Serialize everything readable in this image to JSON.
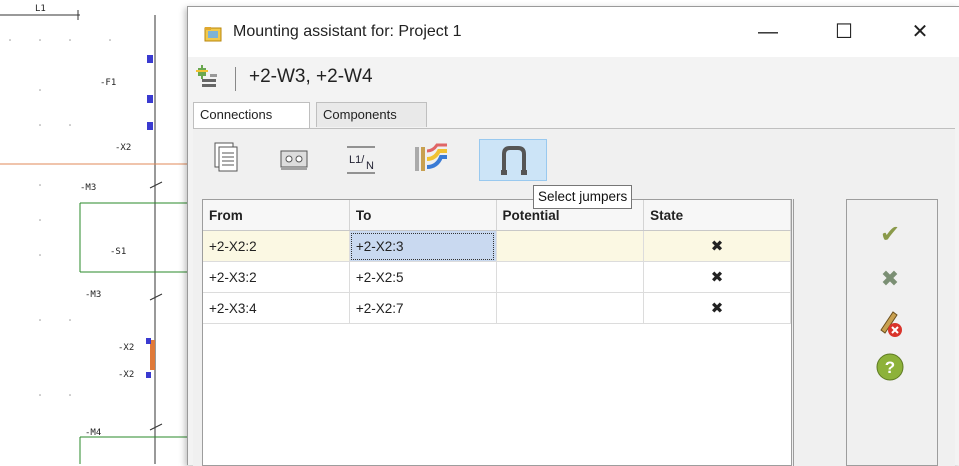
{
  "window": {
    "title": "Mounting assistant for: Project 1",
    "minimize_glyph": "—",
    "maximize_glyph": "☐",
    "close_glyph": "✕"
  },
  "header": {
    "cables": "+2-W3, +2-W4",
    "icon": "cable-connections-icon"
  },
  "tabs": [
    {
      "label": "Connections",
      "active": true
    },
    {
      "label": "Components",
      "active": false
    }
  ],
  "toolbar": {
    "tools": [
      {
        "icon": "document-list-icon"
      },
      {
        "icon": "terminal-icon"
      },
      {
        "icon": "potential-l1-n-icon",
        "label": "L1/N"
      },
      {
        "icon": "wire-bundle-icon"
      },
      {
        "icon": "jumper-icon",
        "active": true
      }
    ],
    "tooltip": "Select jumpers"
  },
  "grid": {
    "columns": [
      "From",
      "To",
      "Potential",
      "State"
    ],
    "rows": [
      {
        "from": "+2-X2:2",
        "to": "+2-X2:3",
        "potential": "",
        "state": "✖"
      },
      {
        "from": "+2-X3:2",
        "to": "+2-X2:5",
        "potential": "",
        "state": "✖"
      },
      {
        "from": "+2-X3:4",
        "to": "+2-X2:7",
        "potential": "",
        "state": "✖"
      }
    ]
  },
  "side_buttons": [
    {
      "icon": "check-icon",
      "glyph": "✔"
    },
    {
      "icon": "cross-icon",
      "glyph": "✖"
    },
    {
      "icon": "edit-delete-icon"
    },
    {
      "icon": "help-icon",
      "glyph": "?"
    }
  ],
  "schematic": {
    "labels": [
      "L1",
      "-F1",
      "-X2",
      "-M3",
      "-S1",
      "-M3",
      "-X2",
      "-X2",
      "-M4"
    ]
  },
  "colors": {
    "accent": "#cce4f7",
    "selected_row": "#fbf8e3",
    "focus_cell": "#c9d9f0",
    "state_icon": "#7b8f74"
  }
}
